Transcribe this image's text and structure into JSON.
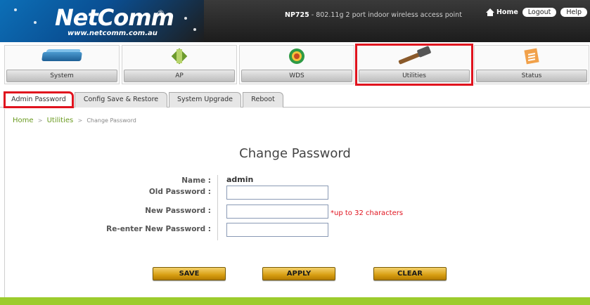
{
  "header": {
    "logo_text": "NetComm",
    "logo_reg": "®",
    "logo_url": "www.netcomm.com.au",
    "model_name": "NP725",
    "model_desc": " - 802.11g 2 port indoor wireless access point",
    "home_label": "Home",
    "logout_label": "Logout",
    "help_label": "Help"
  },
  "nav": {
    "items": [
      {
        "label": "System",
        "icon": "router-icon"
      },
      {
        "label": "AP",
        "icon": "antenna-icon"
      },
      {
        "label": "WDS",
        "icon": "wds-icon"
      },
      {
        "label": "Utilities",
        "icon": "hammer-icon",
        "active": true
      },
      {
        "label": "Status",
        "icon": "notepad-icon"
      }
    ]
  },
  "subtabs": {
    "items": [
      {
        "label": "Admin Password",
        "active": true
      },
      {
        "label": "Config Save & Restore"
      },
      {
        "label": "System Upgrade"
      },
      {
        "label": "Reboot"
      }
    ]
  },
  "breadcrumb": {
    "home": "Home",
    "sep": ">",
    "utilities": "Utilities",
    "current": "Change Password"
  },
  "form": {
    "title": "Change Password",
    "name_label": "Name :",
    "name_value": "admin",
    "old_label": "Old Password :",
    "old_value": "",
    "new_label": "New Password :",
    "new_value": "",
    "new_hint": "*up to 32 characters",
    "reenter_label": "Re-enter New Password :",
    "reenter_value": ""
  },
  "buttons": {
    "save": "SAVE",
    "apply": "APPLY",
    "clear": "CLEAR"
  },
  "colors": {
    "accent_red": "#e0131e",
    "breadcrumb_green": "#6a9a1f",
    "footer_green": "#9ccc2d",
    "button_gold": "#d89f12"
  }
}
